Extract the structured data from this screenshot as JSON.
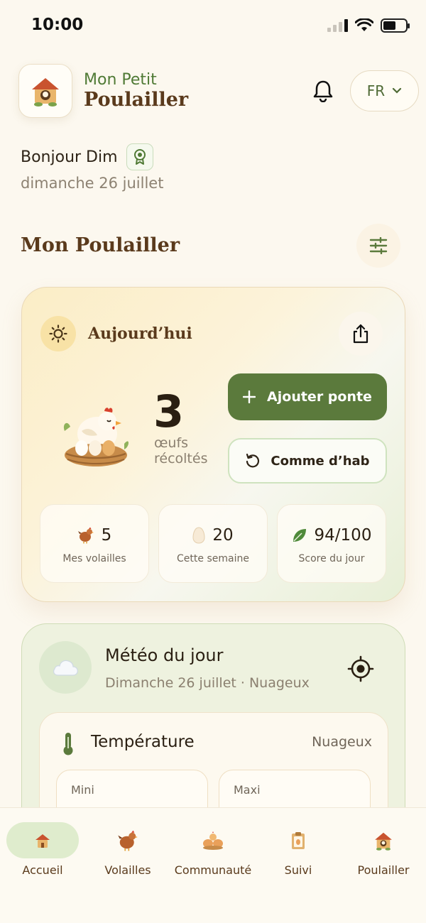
{
  "status_bar": {
    "time": "10:00"
  },
  "header": {
    "brand_line1": "Mon Petit",
    "brand_line2": "Poulailler",
    "language": "FR"
  },
  "greeting": {
    "text": "Bonjour Dim",
    "date": "dimanche 26 juillet"
  },
  "section_title": "Mon Poulailler",
  "today": {
    "label": "Aujourd’hui",
    "egg_count": "3",
    "egg_unit_line1": "œufs",
    "egg_unit_line2": "récoltés",
    "add_button": "Ajouter ponte",
    "usual_button": "Comme d’hab",
    "stats": [
      {
        "value": "5",
        "label": "Mes volailles",
        "icon": "hen-icon"
      },
      {
        "value": "20",
        "label": "Cette semaine",
        "icon": "egg-icon"
      },
      {
        "value": "94/100",
        "label": "Score du jour",
        "icon": "leaf-icon"
      }
    ]
  },
  "weather": {
    "title": "Météo du jour",
    "subtitle": "Dimanche 26 juillet · Nuageux",
    "temperature_title": "Température",
    "condition": "Nuageux",
    "min_label": "Mini",
    "max_label": "Maxi"
  },
  "bottom_nav": [
    {
      "label": "Accueil",
      "icon": "henhouse-icon",
      "active": true
    },
    {
      "label": "Volailles",
      "icon": "hen-icon",
      "active": false
    },
    {
      "label": "Communauté",
      "icon": "chicks-icon",
      "active": false
    },
    {
      "label": "Suivi",
      "icon": "clipboard-icon",
      "active": false
    },
    {
      "label": "Poulailler",
      "icon": "coop-icon",
      "active": false
    }
  ],
  "colors": {
    "background": "#fcf8ef",
    "primary_green": "#5b7a3c",
    "brand_brown": "#5a3a1c",
    "brand_green": "#4f7a35"
  }
}
